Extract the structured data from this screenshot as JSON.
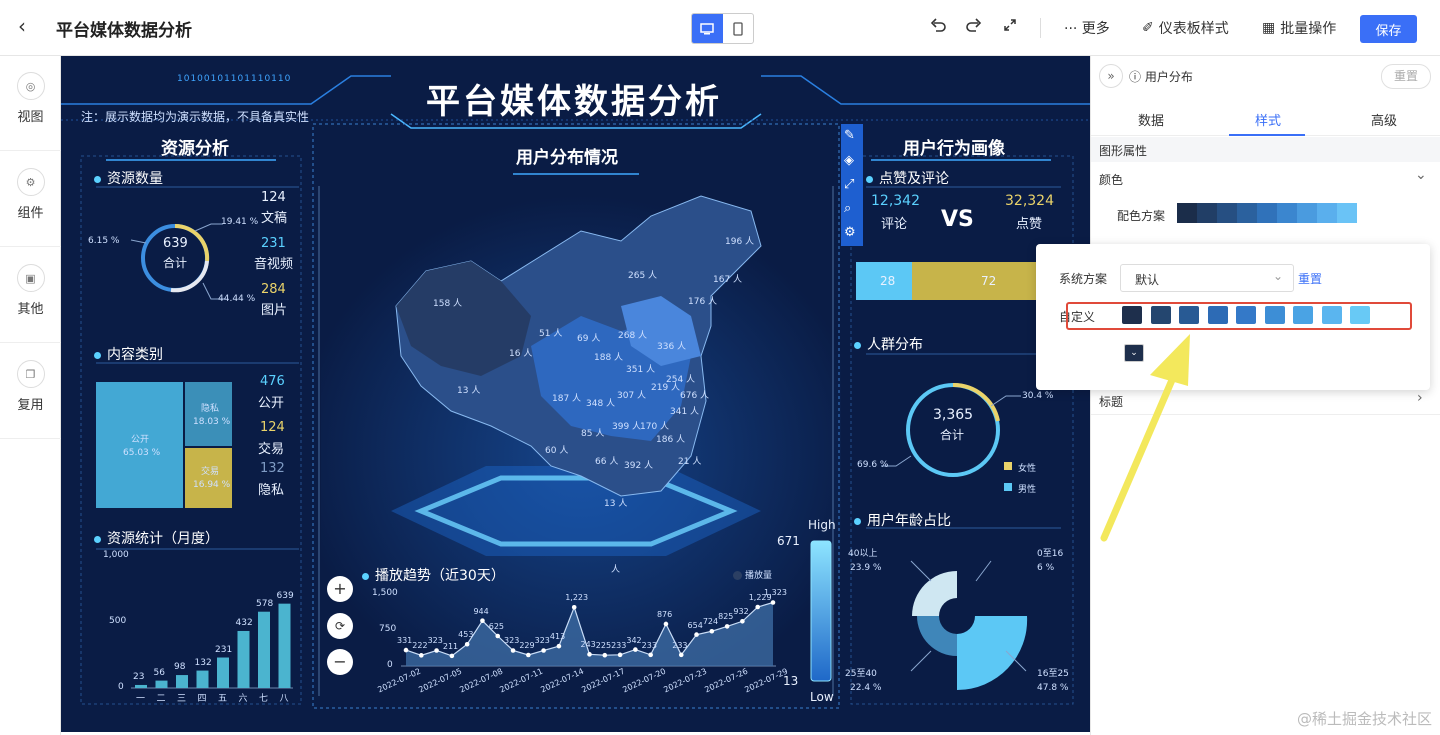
{
  "topbar": {
    "title": "平台媒体数据分析",
    "undo_icon": "undo-icon",
    "redo_icon": "redo-icon",
    "fullscreen_icon": "fullscreen-icon",
    "more_label": "··· 更多",
    "dashboard_style_label": "仪表板样式",
    "batch_label": "批量操作",
    "save_label": "保存"
  },
  "rail": [
    {
      "label": "视图",
      "icon": "view-icon"
    },
    {
      "label": "组件",
      "icon": "component-icon"
    },
    {
      "label": "其他",
      "icon": "other-icon"
    },
    {
      "label": "复用",
      "icon": "reuse-icon"
    }
  ],
  "dashboard": {
    "title": "平台媒体数据分析",
    "note": "注：展示数据均为演示数据，不具备真实性",
    "binary_text": "10100101101110110",
    "resource_section": "资源分析",
    "resource_count": {
      "title": "资源数量",
      "total": "639",
      "total_label": "合计",
      "p1": "19.41 %",
      "p2": "6.15 %",
      "p3": "44.44 %",
      "items": [
        {
          "value": "124",
          "label": "文稿"
        },
        {
          "value": "231",
          "label": "音视频"
        },
        {
          "value": "284",
          "label": "图片"
        }
      ]
    },
    "content_type": {
      "title": "内容类别",
      "blocks": [
        {
          "label": "公开",
          "pct": "65.03 %"
        },
        {
          "label": "隐私",
          "pct": "18.03 %"
        },
        {
          "label": "交易",
          "pct": "16.94 %"
        }
      ],
      "items": [
        {
          "value": "476",
          "label": "公开"
        },
        {
          "value": "124",
          "label": "交易"
        },
        {
          "value": "132",
          "label": "隐私"
        }
      ]
    },
    "monthly": {
      "title": "资源统计（月度）",
      "yticks": [
        "1,000",
        "500",
        "0"
      ]
    },
    "user_dist": {
      "title": "用户分布情况",
      "labels": [
        "196 人",
        "265 人",
        "167 人",
        "158 人",
        "176 人",
        "51 人",
        "69 人",
        "268 人",
        "336 人",
        "16 人",
        "188 人",
        "351 人",
        "13 人",
        "254 人",
        "187 人",
        "348 人",
        "307 人",
        "219 人",
        "676 人",
        "341 人",
        "85 人",
        "399 人",
        "170 人",
        "186 人",
        "60 人",
        "66 人",
        "392 人",
        "21 人",
        "13 人",
        "人"
      ],
      "high": "High",
      "low": "Low",
      "max": "671",
      "min": "13"
    },
    "playback": {
      "title": "播放趋势（近30天）",
      "legend": "播放量",
      "yticks": [
        "1,500",
        "750",
        "0"
      ],
      "dates": [
        "2022-07-02",
        "2022-07-05",
        "2022-07-08",
        "2022-07-11",
        "2022-07-14",
        "2022-07-17",
        "2022-07-20",
        "2022-07-23",
        "2022-07-26",
        "2022-07-29"
      ]
    },
    "behavior_section": "用户行为画像",
    "likes": {
      "title": "点赞及评论",
      "comment_value": "12,342",
      "comment_label": "评论",
      "vs": "VS",
      "like_value": "32,324",
      "like_label": "点赞",
      "bar_left": "28",
      "bar_right": "72"
    },
    "crowd": {
      "title": "人群分布",
      "total": "3,365",
      "total_label": "合计",
      "p_female": "30.4 %",
      "p_male": "69.6 %",
      "legend": [
        "女性",
        "男性"
      ]
    },
    "age": {
      "title": "用户年龄占比",
      "items": [
        {
          "label": "40以上",
          "pct": "23.9 %"
        },
        {
          "label": "0至16",
          "pct": "6 %"
        },
        {
          "label": "25至40",
          "pct": "22.4 %"
        },
        {
          "label": "16至25",
          "pct": "47.8 %"
        }
      ]
    }
  },
  "chart_data": [
    {
      "type": "bar",
      "title": "资源统计（月度）",
      "categories": [
        "一",
        "二",
        "三",
        "四",
        "五",
        "六",
        "七",
        "八"
      ],
      "values": [
        23,
        56,
        98,
        132,
        231,
        432,
        578,
        639
      ],
      "ylim": [
        0,
        1000
      ]
    },
    {
      "type": "area",
      "title": "播放趋势（近30天）",
      "series": [
        {
          "name": "播放量",
          "values": [
            331,
            222,
            323,
            211,
            453,
            944,
            625,
            323,
            229,
            323,
            413,
            1223,
            243,
            225,
            233,
            342,
            233,
            876,
            233,
            654,
            724,
            825,
            932,
            1229,
            1323
          ]
        }
      ],
      "labels": [
        "331",
        "222",
        "323",
        "211",
        "453",
        "944",
        "625",
        "323",
        "229",
        "323",
        "413",
        "1,223",
        "243",
        "225",
        "233",
        "342",
        "233",
        "876",
        "233",
        "654",
        "724",
        "825",
        "932",
        "1,229",
        "1,323"
      ],
      "ylim": [
        0,
        1500
      ]
    }
  ],
  "panel": {
    "component_title": "用户分布",
    "reset_label": "重置",
    "tabs": [
      "数据",
      "样式",
      "高级"
    ],
    "active_tab": "样式",
    "section": "图形属性",
    "color_group": "颜色",
    "scheme_label": "配色方案",
    "popup": {
      "system_label": "系统方案",
      "system_value": "默认",
      "reset": "重置",
      "custom_label": "自定义"
    },
    "title_group": "标题",
    "custom_colors": [
      "#1e2f4c",
      "#24466f",
      "#285a94",
      "#2d6bb5",
      "#3479c8",
      "#3d8ed6",
      "#4aa3e4",
      "#5ab5ef",
      "#68c9f5"
    ],
    "scheme_colors": [
      "#1b2d4a",
      "#213e66",
      "#264f82",
      "#2b619e",
      "#3072ba",
      "#3b86cf",
      "#4a9bdf",
      "#5aafed",
      "#6ac3f6"
    ]
  },
  "watermark": "@稀土掘金技术社区"
}
